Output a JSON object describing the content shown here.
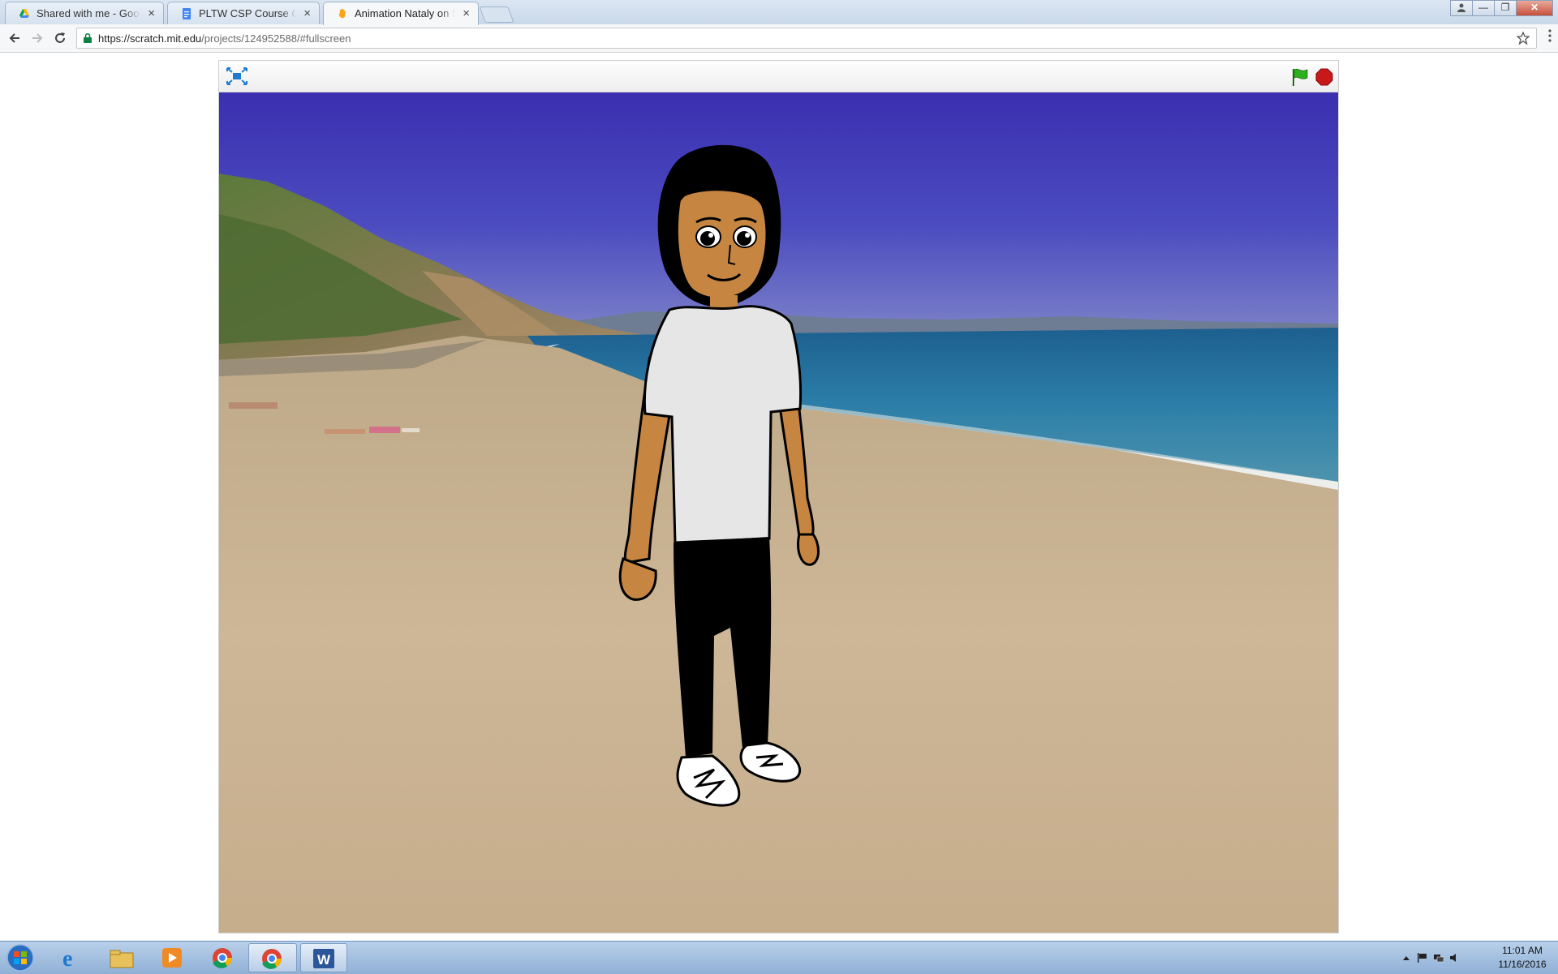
{
  "browser": {
    "tabs": [
      {
        "title": "Shared with me - Google Drive",
        "icon": "google-drive-icon",
        "close": "×",
        "active": false
      },
      {
        "title": "PLTW CSP Course Outline",
        "icon": "google-docs-icon",
        "close": "×",
        "active": false
      },
      {
        "title": "Animation Nataly on Scratch",
        "icon": "scratch-icon",
        "close": "×",
        "active": true
      }
    ],
    "address": {
      "host": "https://scratch.mit.edu",
      "path": "/projects/124952588/#fullscreen"
    },
    "icons": {
      "back": "back-arrow-icon",
      "forward": "forward-arrow-icon",
      "reload": "reload-icon",
      "bookmark": "star-icon",
      "menu": "more-vert-icon",
      "secure": "lock-icon"
    },
    "window_controls": {
      "minimize": "—",
      "restore": "❐",
      "close": "✕"
    }
  },
  "player": {
    "fullscreen_icon": "exit-fullscreen-icon",
    "green_flag_icon": "green-flag-icon",
    "stop_icon": "stop-sign-icon",
    "flag_color": "#2db01e",
    "stop_color": "#c8181a",
    "backdrop": "beach",
    "sprite": "girl-character"
  },
  "taskbar": {
    "apps": [
      {
        "name": "internet-explorer-icon",
        "active": false
      },
      {
        "name": "file-explorer-icon",
        "active": false
      },
      {
        "name": "media-player-icon",
        "active": false
      },
      {
        "name": "chrome-icon",
        "active": false
      },
      {
        "name": "chrome-icon",
        "active": true
      },
      {
        "name": "word-icon",
        "active": true
      }
    ],
    "clock": {
      "time": "11:01 AM",
      "date": "11/16/2016"
    }
  }
}
